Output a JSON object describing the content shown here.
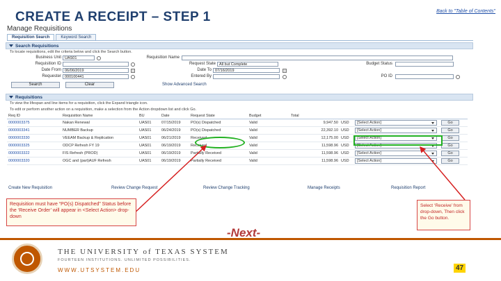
{
  "slide": {
    "title": "CREATE A RECEIPT – STEP 1",
    "back_link": "Back to \"Table of Contents\"",
    "next": "-Next-",
    "page_number": "47"
  },
  "app": {
    "title": "Manage Requisitions",
    "tabs": [
      "Requisition Search",
      "Keyword Search"
    ],
    "search": {
      "header": "Search Requisitions",
      "hint": "To locate requisitions, edit the criteria below and click the Search button.",
      "business_unit_label": "Business Unit",
      "business_unit_value": "UAS01",
      "requisition_id_label": "Requisition ID",
      "requisition_name_label": "Requisition Name",
      "request_state_label": "Request State",
      "request_state_value": "All but Complete",
      "budget_status_label": "Budget Status",
      "date_from_label": "Date From",
      "date_from_value": "06/06/2019",
      "date_to_label": "Date To",
      "date_to_value": "07/16/2019",
      "requester_label": "Requester",
      "requester_value": "000100441",
      "entered_by_label": "Entered By",
      "po_id_label": "PO ID",
      "search_button": "Search",
      "clear_button": "Clear",
      "advanced_search": "Show Advanced Search"
    },
    "requisitions": {
      "header": "Requisitions",
      "hint1": "To view the lifespan and line items for a requisition, click the Expand triangle icon.",
      "hint2": "To edit or perform another action on a requisition, make a selection from the Action dropdown list and click Go.",
      "columns": [
        "Req ID",
        "Requisition Name",
        "BU",
        "Date",
        "Request State",
        "Budget",
        "Total",
        "",
        ""
      ],
      "rows": [
        {
          "id": "0000003375",
          "name": "Nakan Renewal",
          "bu": "UAS01",
          "date": "07/15/2019",
          "state": "PO(s) Dispatched",
          "budget": "Valid",
          "total": "9,947.50",
          "currency": "USD",
          "action": "[Select Action]",
          "go": "Go"
        },
        {
          "id": "0000003341",
          "name": "NUMBER Backup",
          "bu": "UAS01",
          "date": "06/24/2019",
          "state": "PO(s) Dispatched",
          "budget": "Valid",
          "total": "22,392.10",
          "currency": "USD",
          "action": "[Select Action]",
          "go": "Go"
        },
        {
          "id": "0000003330",
          "name": "VEEAM Backup & Replication",
          "bu": "UAS01",
          "date": "06/21/2019",
          "state": "Received",
          "budget": "Valid",
          "total": "12,175.00",
          "currency": "USD",
          "action": "[Select Action]",
          "go": "Go"
        },
        {
          "id": "0000003325",
          "name": "ODCP Refresh FY 19",
          "bu": "UAS01",
          "date": "06/19/2019",
          "state": "Received",
          "budget": "Valid",
          "total": "11,598.96",
          "currency": "USD",
          "action": "[Select Action]",
          "go": "Go"
        },
        {
          "id": "0000003322",
          "name": "FIS Refresh (PROD)",
          "bu": "UAS01",
          "date": "06/19/2019",
          "state": "Partially Received",
          "budget": "Valid",
          "total": "11,598.96",
          "currency": "USD",
          "action": "[Select Action]",
          "go": "Go"
        },
        {
          "id": "0000003320",
          "name": "OGC and (part)AUF Refresh",
          "bu": "UAS01",
          "date": "06/19/2019",
          "state": "Partially Received",
          "budget": "Valid",
          "total": "11,598.96",
          "currency": "USD",
          "action": "[Select Action]",
          "go": "Go"
        }
      ]
    },
    "bottom_links": [
      "Create New Requisition",
      "Review Change Request",
      "Review Change Tracking",
      "Manage Receipts",
      "Requisition Report"
    ]
  },
  "notes": {
    "left": "Requisition must have “PO(s) Dispatched” Status before the ‘Receive Order’ will appear in <Select Action> drop-down",
    "right": "Select ‘Receive’ from drop-down, Then click the Go button."
  },
  "footer": {
    "university": "THE UNIVERSITY of TEXAS SYSTEM",
    "tagline": "FOURTEEN INSTITUTIONS. UNLIMITED POSSIBILITIES.",
    "url": "WWW.UTSYSTEM.EDU"
  },
  "colors": {
    "title": "#1f3f6e",
    "accent_orange": "#bf5700",
    "highlight_green": "#21b021",
    "note_red": "#c02424"
  }
}
